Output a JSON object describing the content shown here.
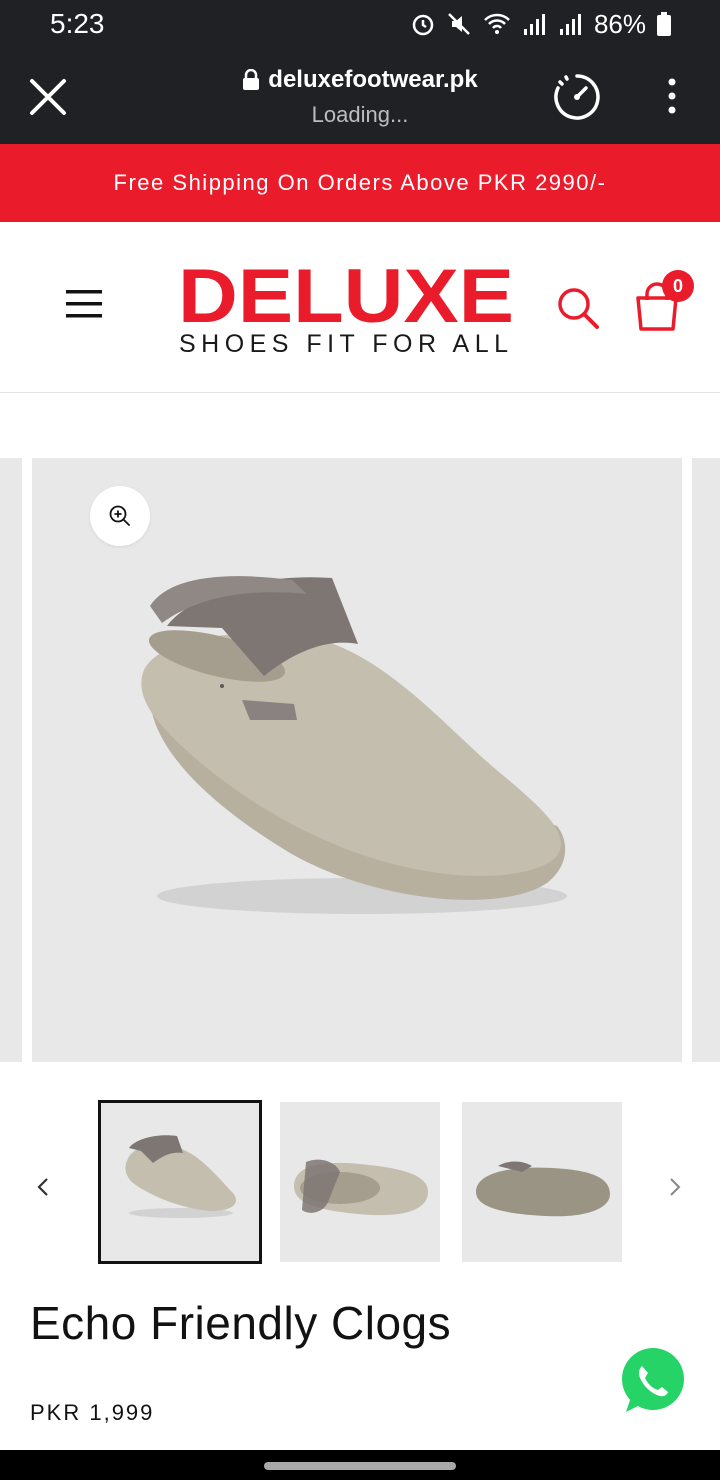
{
  "status": {
    "time": "5:23",
    "battery": "86%"
  },
  "browser": {
    "url": "deluxefootwear.pk",
    "status": "Loading..."
  },
  "announcement": "Free Shipping On Orders Above PKR 2990/-",
  "header": {
    "logo_text": "DELUXE",
    "tagline": "SHOES FIT FOR ALL",
    "cart_count": "0"
  },
  "product": {
    "title": "Echo Friendly Clogs",
    "price": "PKR 1,999"
  },
  "colors": {
    "brand_red": "#ea1c2b",
    "dark_bar": "#202124",
    "image_bg": "#e8e8e8",
    "shoe": "#c3bdae",
    "strap": "#8a8281",
    "whatsapp": "#25d366"
  },
  "icons": [
    "close-icon",
    "lock-icon",
    "speed-icon",
    "more-vert-icon",
    "menu-icon",
    "search-icon",
    "cart-icon",
    "zoom-in-icon",
    "chevron-left-icon",
    "chevron-right-icon",
    "whatsapp-icon"
  ]
}
